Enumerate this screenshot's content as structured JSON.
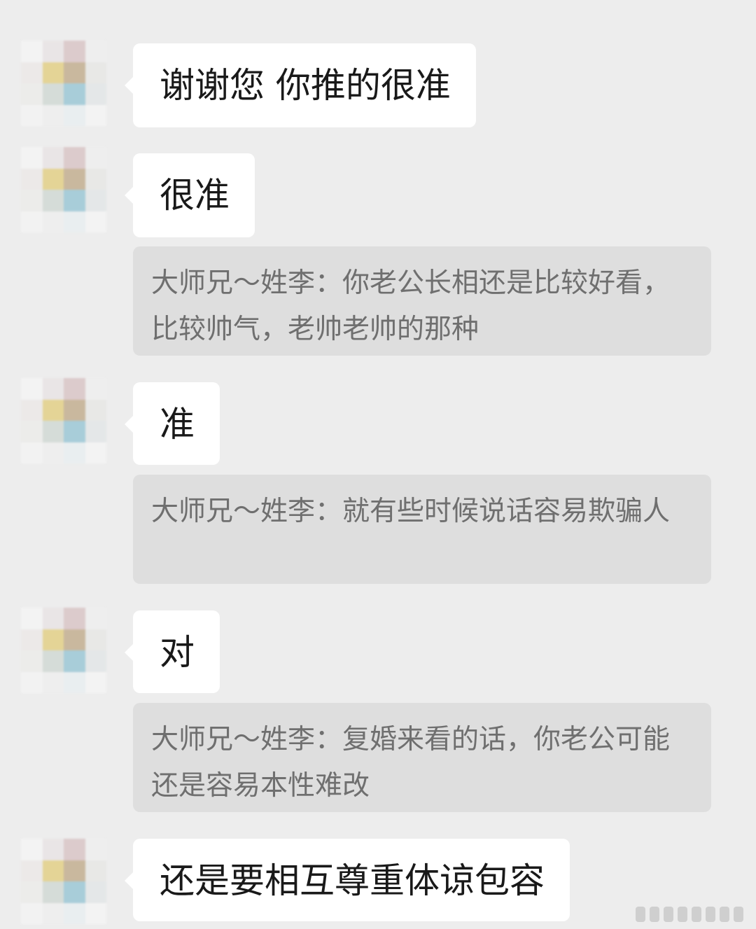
{
  "messages": [
    {
      "text": "谢谢您 你推的很准"
    },
    {
      "text": "很准",
      "quote": "大师兄～姓李：你老公长相还是比较好看，比较帅气，老帅老帅的那种"
    },
    {
      "text": "准",
      "quote": "大师兄～姓李：就有些时候说话容易欺骗人"
    },
    {
      "text": "对",
      "quote": "大师兄～姓李：复婚来看的话，你老公可能还是容易本性难改"
    },
    {
      "text": "还是要相互尊重体谅包容"
    }
  ],
  "colors": {
    "background": "#ededed",
    "bubble": "#ffffff",
    "quote_background": "#dedede",
    "quote_text": "#6f6f6f",
    "bubble_text": "#191919"
  },
  "avatar": {
    "icon": "blurred-avatar-icon",
    "palette": [
      "#f3f3f3",
      "#e9e5e6",
      "#dccbcc",
      "#eeeeee",
      "#ece9e8",
      "#e4d496",
      "#c9b89e",
      "#e8e8e6",
      "#ececea",
      "#d5dcd8",
      "#a8cdd9",
      "#e4e7e8",
      "#f2f2f2",
      "#eeeeee",
      "#e9eef0",
      "#f3f3f3"
    ]
  }
}
